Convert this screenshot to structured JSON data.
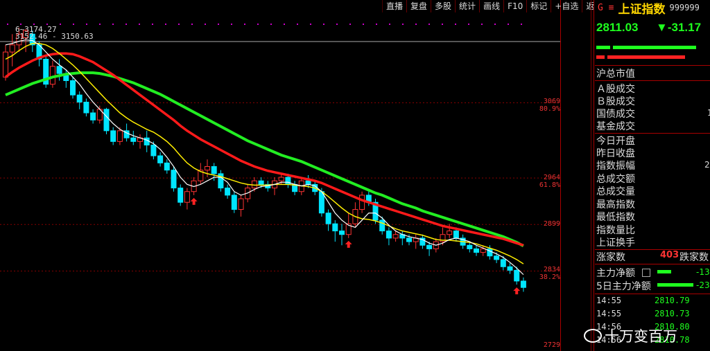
{
  "toolbar": [
    "直播",
    "复盘",
    "多股",
    "统计",
    "画线",
    "F10",
    "标记",
    "+自选",
    "返回"
  ],
  "index": {
    "prefix": "G ≡",
    "name": "上证指数",
    "code": "999999",
    "price": "2811.03",
    "change": "▼-31.17"
  },
  "legend": {
    "line1": "6~3174.27",
    "line2": "3152.46 - 3150.63"
  },
  "y_axis": [
    {
      "value": "3069",
      "pct": "80.9%"
    },
    {
      "value": "2964",
      "pct": "61.8%"
    },
    {
      "value": "2899",
      "pct": ""
    },
    {
      "value": "2834",
      "pct": "38.2%"
    },
    {
      "value": "2729",
      "pct": ""
    }
  ],
  "stats": {
    "total_cap": "沪总市值",
    "a_vol": "Ａ股成交",
    "b_vol": "Ｂ股成交",
    "bond_vol": "国债成交",
    "fund_vol": "基金成交",
    "open": "今日开盘",
    "prev_close": "昨日收盘",
    "amplitude": "指数振幅",
    "amplitude_val": "2",
    "turnover": "总成交额",
    "volume": "总成交量",
    "high": "最高指数",
    "low": "最低指数",
    "vol_ratio": "指数量比",
    "turnover_rate": "上证换手",
    "bond_val": "1",
    "up_label": "涨家数",
    "up_count": "403",
    "down_label": "跌家数",
    "main_net": "主力净额",
    "main_net_val": "-13",
    "main_net5": "5日主力净额",
    "main_net5_val": "-23"
  },
  "ticks": [
    {
      "time": "14:55",
      "price": "2810.79"
    },
    {
      "time": "14:55",
      "price": "2810.73"
    },
    {
      "time": "14:56",
      "price": "2810.80"
    },
    {
      "time": "14:56",
      "price": "2810.78"
    }
  ],
  "watermark": "十万变百万",
  "colors": {
    "up": "#ff3333",
    "down": "#00e5ff",
    "ma_white": "#ffffff",
    "ma_yellow": "#ffee00",
    "ma_red": "#ff1a1a",
    "ma_green": "#22ee22"
  },
  "chart_data": {
    "type": "candlestick",
    "y_range": [
      2729,
      3174
    ],
    "candles": [
      [
        3105,
        3140,
        3100,
        3150
      ],
      [
        3140,
        3150,
        3120,
        3165
      ],
      [
        3150,
        3165,
        3140,
        3174
      ],
      [
        3160,
        3170,
        3140,
        3172
      ],
      [
        3165,
        3150,
        3140,
        3170
      ],
      [
        3150,
        3130,
        3120,
        3155
      ],
      [
        3130,
        3095,
        3090,
        3135
      ],
      [
        3095,
        3120,
        3090,
        3128
      ],
      [
        3120,
        3110,
        3100,
        3130
      ],
      [
        3110,
        3100,
        3090,
        3115
      ],
      [
        3100,
        3080,
        3075,
        3105
      ],
      [
        3080,
        3070,
        3060,
        3085
      ],
      [
        3070,
        3055,
        3050,
        3075
      ],
      [
        3055,
        3045,
        3040,
        3060
      ],
      [
        3045,
        3060,
        3040,
        3065
      ],
      [
        3060,
        3030,
        3025,
        3062
      ],
      [
        3030,
        3015,
        3010,
        3035
      ],
      [
        3015,
        3030,
        3010,
        3035
      ],
      [
        3030,
        3020,
        3015,
        3040
      ],
      [
        3020,
        3015,
        3010,
        3030
      ],
      [
        3015,
        3020,
        3005,
        3025
      ],
      [
        3020,
        3010,
        3000,
        3030
      ],
      [
        3010,
        2995,
        2990,
        3015
      ],
      [
        2995,
        2985,
        2980,
        3000
      ],
      [
        2985,
        2975,
        2970,
        2990
      ],
      [
        2975,
        2950,
        2945,
        2980
      ],
      [
        2950,
        2930,
        2925,
        2955
      ],
      [
        2930,
        2945,
        2920,
        2950
      ],
      [
        2945,
        2960,
        2940,
        2965
      ],
      [
        2960,
        2975,
        2955,
        2985
      ],
      [
        2975,
        2980,
        2965,
        2990
      ],
      [
        2980,
        2970,
        2960,
        2985
      ],
      [
        2970,
        2950,
        2945,
        2975
      ],
      [
        2950,
        2940,
        2935,
        2955
      ],
      [
        2940,
        2920,
        2915,
        2945
      ],
      [
        2920,
        2935,
        2910,
        2940
      ],
      [
        2935,
        2950,
        2930,
        2955
      ],
      [
        2950,
        2960,
        2945,
        2965
      ],
      [
        2960,
        2955,
        2950,
        2965
      ],
      [
        2955,
        2950,
        2945,
        2960
      ],
      [
        2950,
        2960,
        2940,
        2965
      ],
      [
        2960,
        2965,
        2955,
        2970
      ],
      [
        2965,
        2955,
        2950,
        2970
      ],
      [
        2955,
        2945,
        2940,
        2960
      ],
      [
        2945,
        2960,
        2940,
        2965
      ],
      [
        2960,
        2955,
        2950,
        2968
      ],
      [
        2955,
        2945,
        2940,
        2960
      ],
      [
        2945,
        2915,
        2910,
        2950
      ],
      [
        2915,
        2900,
        2890,
        2920
      ],
      [
        2900,
        2890,
        2875,
        2905
      ],
      [
        2890,
        2885,
        2870,
        2900
      ],
      [
        2885,
        2900,
        2880,
        2915
      ],
      [
        2900,
        2920,
        2895,
        2930
      ],
      [
        2920,
        2940,
        2915,
        2945
      ],
      [
        2940,
        2930,
        2925,
        2945
      ],
      [
        2930,
        2905,
        2900,
        2935
      ],
      [
        2905,
        2890,
        2885,
        2910
      ],
      [
        2890,
        2880,
        2870,
        2895
      ],
      [
        2880,
        2885,
        2875,
        2890
      ],
      [
        2885,
        2880,
        2870,
        2890
      ],
      [
        2880,
        2875,
        2870,
        2885
      ],
      [
        2875,
        2880,
        2865,
        2885
      ],
      [
        2880,
        2870,
        2865,
        2885
      ],
      [
        2870,
        2865,
        2855,
        2875
      ],
      [
        2865,
        2875,
        2860,
        2880
      ],
      [
        2875,
        2885,
        2870,
        2895
      ],
      [
        2885,
        2890,
        2880,
        2900
      ],
      [
        2890,
        2880,
        2875,
        2895
      ],
      [
        2880,
        2870,
        2865,
        2885
      ],
      [
        2870,
        2865,
        2860,
        2875
      ],
      [
        2865,
        2860,
        2855,
        2870
      ],
      [
        2860,
        2865,
        2855,
        2870
      ],
      [
        2865,
        2855,
        2850,
        2870
      ],
      [
        2855,
        2850,
        2845,
        2860
      ],
      [
        2850,
        2840,
        2835,
        2855
      ],
      [
        2840,
        2835,
        2830,
        2845
      ],
      [
        2835,
        2820,
        2815,
        2840
      ],
      [
        2820,
        2811,
        2805,
        2825
      ]
    ],
    "ma_white": [
      3150,
      3152,
      3155,
      3157,
      3156,
      3150,
      3140,
      3130,
      3122,
      3115,
      3105,
      3095,
      3082,
      3070,
      3060,
      3050,
      3040,
      3032,
      3027,
      3023,
      3020,
      3017,
      3012,
      3004,
      2993,
      2980,
      2965,
      2955,
      2952,
      2955,
      2960,
      2965,
      2965,
      2958,
      2945,
      2940,
      2943,
      2948,
      2952,
      2953,
      2955,
      2958,
      2958,
      2955,
      2953,
      2955,
      2953,
      2945,
      2930,
      2915,
      2905,
      2898,
      2895,
      2905,
      2915,
      2915,
      2908,
      2898,
      2890,
      2885,
      2882,
      2880,
      2878,
      2873,
      2870,
      2873,
      2878,
      2880,
      2878,
      2875,
      2870,
      2866,
      2862,
      2858,
      2853,
      2846,
      2838,
      2829
    ],
    "ma_yellow": [
      3130,
      3135,
      3142,
      3148,
      3152,
      3152,
      3150,
      3145,
      3138,
      3130,
      3122,
      3113,
      3103,
      3093,
      3083,
      3073,
      3064,
      3055,
      3048,
      3042,
      3037,
      3032,
      3028,
      3022,
      3015,
      3006,
      2995,
      2985,
      2978,
      2973,
      2970,
      2968,
      2966,
      2963,
      2960,
      2957,
      2955,
      2954,
      2954,
      2954,
      2955,
      2955,
      2955,
      2954,
      2953,
      2952,
      2950,
      2945,
      2938,
      2930,
      2922,
      2915,
      2910,
      2907,
      2906,
      2904,
      2901,
      2897,
      2893,
      2890,
      2888,
      2886,
      2884,
      2881,
      2878,
      2877,
      2877,
      2876,
      2875,
      2874,
      2872,
      2869,
      2866,
      2863,
      2859,
      2855,
      2850,
      2844
    ],
    "ma_red": [
      3105,
      3112,
      3118,
      3123,
      3128,
      3132,
      3135,
      3137,
      3138,
      3138,
      3137,
      3134,
      3130,
      3126,
      3120,
      3114,
      3108,
      3101,
      3094,
      3087,
      3080,
      3073,
      3066,
      3059,
      3052,
      3045,
      3037,
      3030,
      3024,
      3018,
      3013,
      3008,
      3003,
      2998,
      2993,
      2988,
      2984,
      2980,
      2977,
      2974,
      2972,
      2970,
      2968,
      2966,
      2964,
      2962,
      2960,
      2957,
      2953,
      2949,
      2945,
      2941,
      2937,
      2933,
      2930,
      2927,
      2924,
      2921,
      2918,
      2915,
      2912,
      2909,
      2906,
      2903,
      2900,
      2897,
      2895,
      2893,
      2891,
      2889,
      2887,
      2885,
      2883,
      2881,
      2879,
      2876,
      2873,
      2870
    ],
    "ma_green": [
      3080,
      3084,
      3088,
      3092,
      3096,
      3099,
      3102,
      3105,
      3107,
      3109,
      3110,
      3111,
      3111,
      3111,
      3110,
      3108,
      3106,
      3103,
      3100,
      3097,
      3093,
      3089,
      3085,
      3081,
      3076,
      3071,
      3066,
      3061,
      3056,
      3051,
      3046,
      3041,
      3036,
      3031,
      3026,
      3021,
      3016,
      3012,
      3008,
      3004,
      3000,
      2996,
      2993,
      2990,
      2987,
      2983,
      2979,
      2975,
      2971,
      2967,
      2963,
      2959,
      2955,
      2951,
      2947,
      2943,
      2940,
      2936,
      2932,
      2928,
      2925,
      2922,
      2918,
      2915,
      2912,
      2909,
      2906,
      2903,
      2900,
      2897,
      2894,
      2891,
      2888,
      2885,
      2882,
      2878,
      2874,
      2869
    ]
  }
}
